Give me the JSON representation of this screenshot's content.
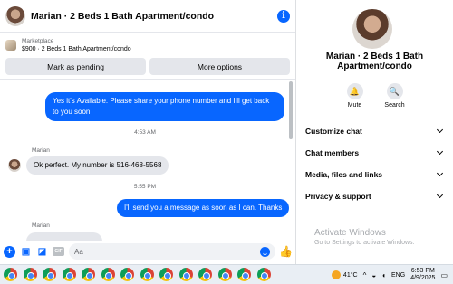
{
  "header": {
    "title": "Marian · 2 Beds 1 Bath Apartment/condo",
    "info_icon": "info-icon"
  },
  "marketplace": {
    "source": "Marketplace",
    "listing": "$900 · 2 Beds 1 Bath Apartment/condo",
    "mark_pending_label": "Mark as pending",
    "more_options_label": "More options"
  },
  "messages": [
    {
      "direction": "out",
      "text": "Yes it's Available. Please share your phone number and I'll get back to you soon"
    },
    {
      "type": "timestamp",
      "text": "4:53 AM"
    },
    {
      "direction": "in",
      "sender": "Marian",
      "text": "Ok perfect. My number is 516-468-5568"
    },
    {
      "type": "timestamp",
      "text": "5:55 PM"
    },
    {
      "direction": "out",
      "text": "I'll send you a message as soon as I can. Thanks"
    },
    {
      "direction": "in",
      "sender": "Marian",
      "text": ""
    }
  ],
  "composer": {
    "placeholder": "Aa"
  },
  "profile": {
    "name": "Marian · 2 Beds 1 Bath Apartment/condo",
    "mute_label": "Mute",
    "search_label": "Search"
  },
  "menu": [
    {
      "label": "Customize chat"
    },
    {
      "label": "Chat members"
    },
    {
      "label": "Media, files and links"
    },
    {
      "label": "Privacy & support"
    }
  ],
  "watermark": {
    "line1": "Activate Windows",
    "line2": "Go to Settings to activate Windows."
  },
  "taskbar": {
    "icon_count": 14,
    "weather": "41°C",
    "language": "ENG",
    "time": "6:53 PM",
    "date": "4/9/2025"
  },
  "colors": {
    "accent": "#0866ff",
    "bubble_in": "#e4e6eb"
  }
}
